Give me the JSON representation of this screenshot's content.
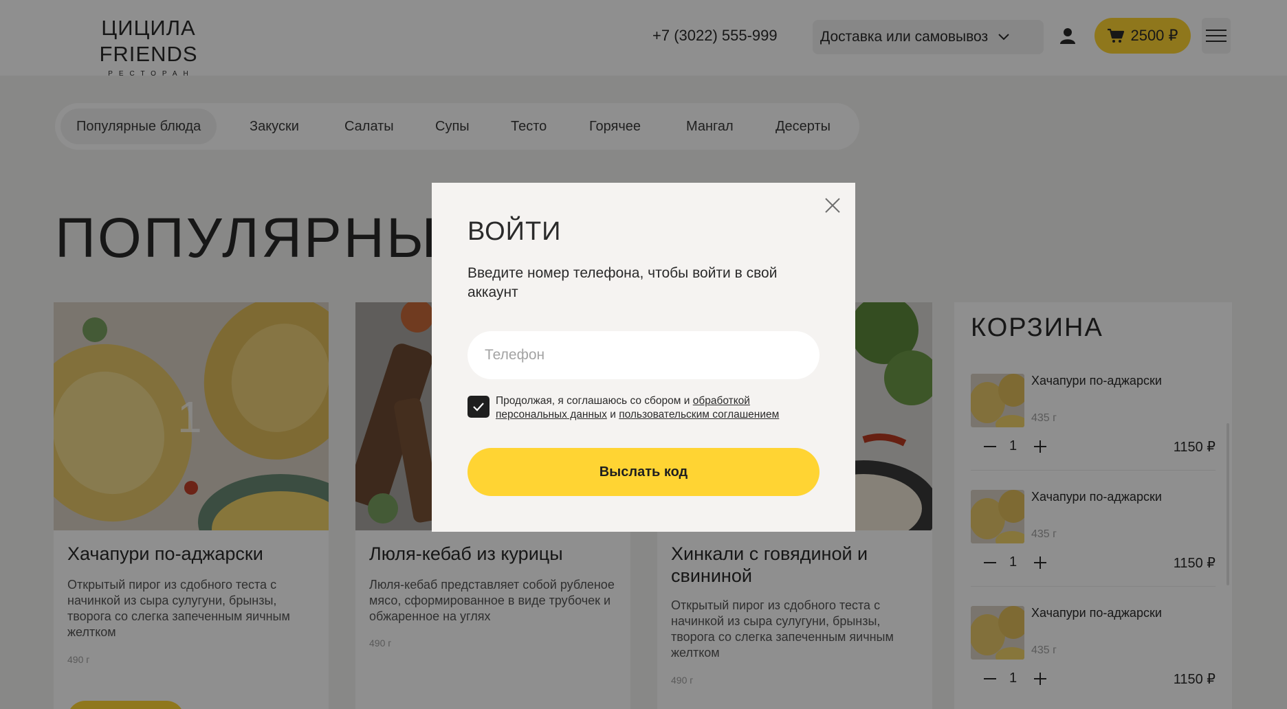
{
  "header": {
    "logo_main": "ЦИЦИЛА FRIENDS",
    "logo_sub": "РЕСТОРАН",
    "phone": "+7 (3022) 555-999",
    "delivery_label": "Доставка или самовывоз",
    "cart_label": "2500 ₽"
  },
  "categories": [
    "Популярные блюда",
    "Закуски",
    "Салаты",
    "Супы",
    "Тесто",
    "Горячее",
    "Мангал",
    "Десерты"
  ],
  "page_title": "ПОПУЛЯРНЫ",
  "cards": [
    {
      "title": "Хачапури по-аджарски",
      "description": "Открытый пирог из сдобного теста с начинкой из сыра сулугуни, брынзы, творога со слегка запеченным яичным желтком",
      "weight": "490 г",
      "badge": "1"
    },
    {
      "title": "Люля-кебаб из курицы",
      "description": "Люля-кебаб представляет собой рубленое мясо, сформированное в виде трубочек и обжаренное на углях",
      "weight": "490 г"
    },
    {
      "title": "Хинкали с говядиной и свининой",
      "description": "Открытый пирог из сдобного теста с начинкой из сыра сулугуни, брынзы, творога со слегка запеченным яичным желтком",
      "weight": "490 г"
    }
  ],
  "cart": {
    "title": "КОРЗИНА",
    "items": [
      {
        "name": "Хачапури по-аджарски",
        "weight": "435 г",
        "qty": "1",
        "price": "1150 ₽"
      },
      {
        "name": "Хачапури по-аджарски",
        "weight": "435 г",
        "qty": "1",
        "price": "1150 ₽"
      },
      {
        "name": "Хачапури по-аджарски",
        "weight": "435 г",
        "qty": "1",
        "price": "1150 ₽"
      }
    ]
  },
  "modal": {
    "title": "ВОЙТИ",
    "text": "Введите номер телефона, чтобы войти в свой аккаунт",
    "phone_placeholder": "Телефон",
    "phone_value": "",
    "consent_prefix": "Продолжая, я соглашаюсь со сбором и",
    "consent_link1": "обработкой персональных данных",
    "consent_and": "и",
    "consent_link2": "пользовательским соглашением",
    "consent_checked": true,
    "submit_label": "Выслать код"
  },
  "colors": {
    "accent": "#ffd433",
    "text": "#2a2a2a",
    "overlay": "rgba(0,0,0,0.44)"
  },
  "icons": [
    "chevron-down-icon",
    "user-icon",
    "cart-icon",
    "hamburger-icon",
    "close-icon",
    "checkmark-icon",
    "minus-icon",
    "plus-icon"
  ]
}
